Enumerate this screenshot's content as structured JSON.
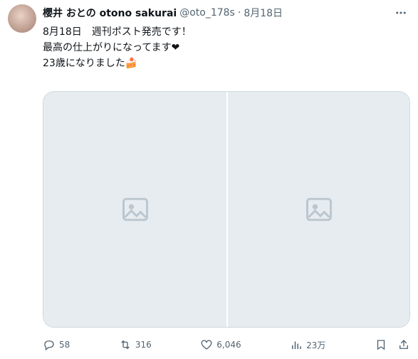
{
  "tweet": {
    "display_name": "櫻井 おとの otono sakurai",
    "handle": "@oto_178s",
    "separator": "·",
    "date": "8月18日",
    "lines": [
      "8月18日　週刊ポスト発売です！",
      "最高の仕上がりになってます❤",
      "",
      "23歳になりました🍰"
    ],
    "media": [
      {
        "placeholder": ""
      },
      {
        "placeholder": ""
      }
    ]
  },
  "actions": {
    "reply_count": "58",
    "repost_count": "316",
    "like_count": "6,046",
    "views_count": "23万"
  },
  "colors": {
    "text": "#0f1419",
    "muted": "#536471",
    "border": "#cfd9de"
  },
  "icons": [
    "more-icon",
    "reply-icon",
    "repost-icon",
    "like-icon",
    "views-icon",
    "bookmark-icon",
    "share-icon"
  ]
}
